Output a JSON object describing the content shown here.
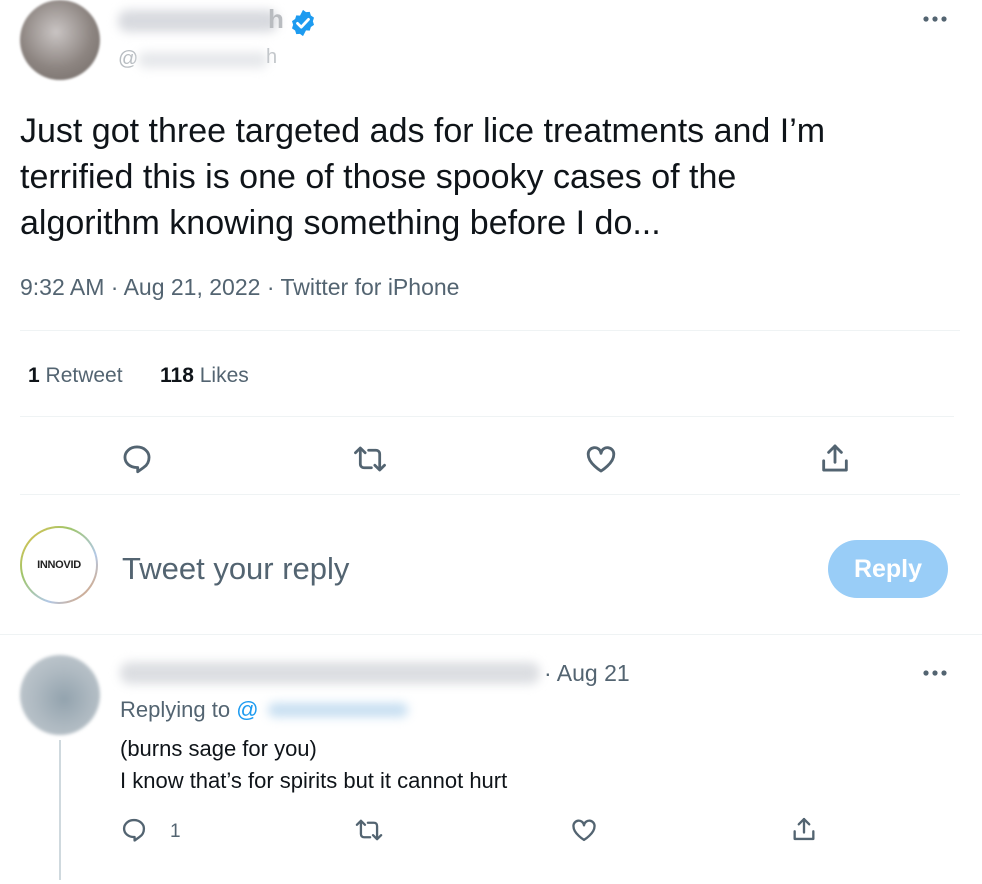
{
  "main_tweet": {
    "author_name_fragment": "h",
    "handle_prefix": "@",
    "handle_fragment": "h",
    "text_line1": "Just got three targeted ads for lice treatments and I’m",
    "text_line2": "terrified this is one of those spooky cases of the",
    "text_line3": "algorithm knowing something before I do...",
    "time": "9:32 AM",
    "date": "Aug 21, 2022",
    "source": "Twitter for iPhone",
    "sep": "·",
    "retweet_count": "1",
    "retweet_label": "Retweet",
    "likes_count": "118",
    "likes_label": "Likes"
  },
  "reply_box": {
    "avatar_logo": "INNOVID",
    "placeholder": "Tweet your reply",
    "button_label": "Reply"
  },
  "reply": {
    "date": "· Aug 21",
    "replying_to_label": "Replying to",
    "replying_to_handle_prefix": "@",
    "line1": "(burns sage for you)",
    "line2": "I know that’s for spirits but it cannot hurt",
    "reply_count": "1"
  },
  "icons": {
    "more": "more-horizontal-icon",
    "verified": "verified-badge-icon",
    "reply": "reply-icon",
    "retweet": "retweet-icon",
    "like": "heart-icon",
    "share": "share-icon"
  },
  "colors": {
    "accent": "#1d9bf0",
    "reply_button_disabled": "#99cdf7",
    "secondary_text": "#536471"
  }
}
